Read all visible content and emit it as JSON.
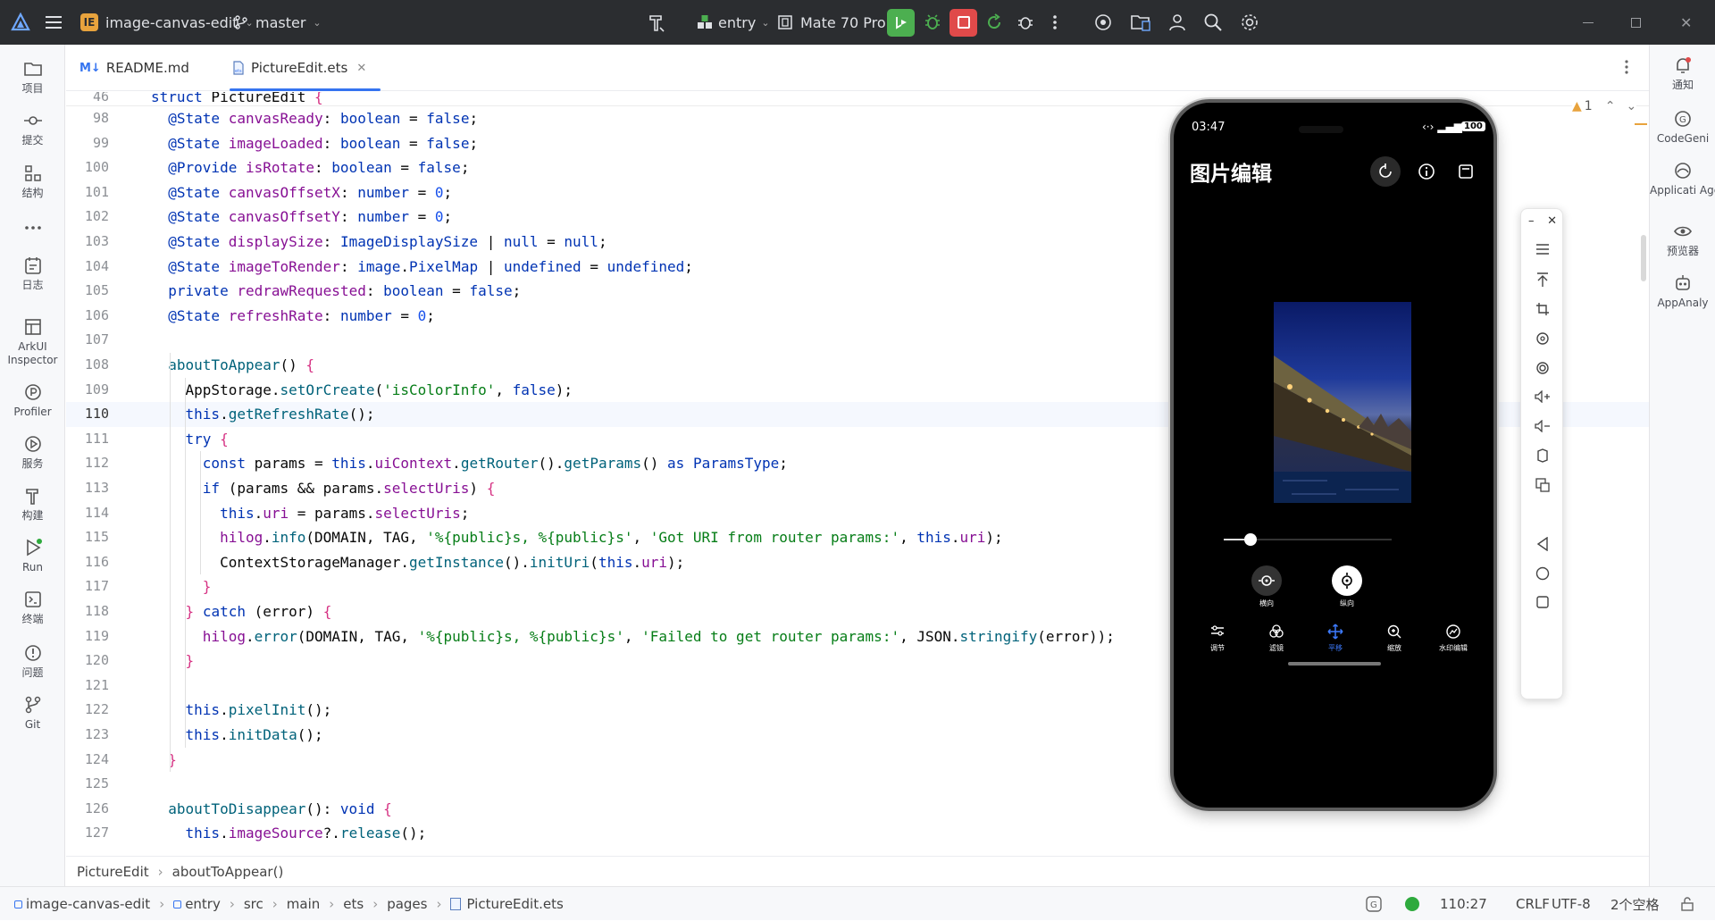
{
  "titlebar": {
    "project_badge": "IE",
    "project_name": "image-canvas-edit",
    "branch": "master",
    "run_config": "entry",
    "device": "Mate 70 Pro"
  },
  "colors": {
    "titlebar_bg": "#2b2d30",
    "run_green": "#4caf50",
    "stop_red": "#e04a4a",
    "project_badge": "#e8a33d",
    "accent_blue": "#3574f0",
    "phone_accent": "#3d7bff"
  },
  "leftbar": [
    {
      "label": "项目",
      "icon": "folder-icon"
    },
    {
      "label": "提交",
      "icon": "commit-icon"
    },
    {
      "label": "结构",
      "icon": "structure-icon"
    },
    {
      "label": "",
      "icon": "more-icon"
    },
    {
      "label": "日志",
      "icon": "log-icon"
    },
    {
      "label": "ArkUI Inspector",
      "icon": "inspector-icon"
    },
    {
      "label": "Profiler",
      "icon": "profiler-icon"
    },
    {
      "label": "服务",
      "icon": "services-icon"
    },
    {
      "label": "构建",
      "icon": "build-icon"
    },
    {
      "label": "Run",
      "icon": "run-icon"
    },
    {
      "label": "终端",
      "icon": "terminal-icon"
    },
    {
      "label": "问题",
      "icon": "problems-icon"
    },
    {
      "label": "Git",
      "icon": "git-icon"
    }
  ],
  "rightbar": [
    {
      "label": "通知",
      "icon": "bell-icon"
    },
    {
      "label": "CodeGeni",
      "icon": "codegenie-icon"
    },
    {
      "label": "Applicati Agent",
      "icon": "agent-icon"
    },
    {
      "label": "预览器",
      "icon": "eye-icon"
    },
    {
      "label": "AppAnaly",
      "icon": "robot-icon"
    }
  ],
  "tabs": [
    {
      "label": "README.md",
      "prefix": "M↓",
      "active": false
    },
    {
      "label": "PictureEdit.ets",
      "active": true
    }
  ],
  "editor": {
    "warning_count": "1",
    "sticky_line": {
      "num": "46",
      "html": "<span class='kw'>struct</span> PictureEdit <span class='br'>{</span>"
    },
    "current_line": "110",
    "lines": [
      {
        "num": "98",
        "html": "  <span class='kw'>@State</span> <span class='fl'>canvasReady</span>: <span class='ty'>boolean</span> = <span class='lit'>false</span>;"
      },
      {
        "num": "99",
        "html": "  <span class='kw'>@State</span> <span class='fl'>imageLoaded</span>: <span class='ty'>boolean</span> = <span class='lit'>false</span>;"
      },
      {
        "num": "100",
        "html": "  <span class='kw'>@Provide</span> <span class='fl'>isRotate</span>: <span class='ty'>boolean</span> = <span class='lit'>false</span>;"
      },
      {
        "num": "101",
        "html": "  <span class='kw'>@State</span> <span class='fl'>canvasOffsetX</span>: <span class='ty'>number</span> = <span class='nm'>0</span>;"
      },
      {
        "num": "102",
        "html": "  <span class='kw'>@State</span> <span class='fl'>canvasOffsetY</span>: <span class='ty'>number</span> = <span class='nm'>0</span>;"
      },
      {
        "num": "103",
        "html": "  <span class='kw'>@State</span> <span class='fl'>displaySize</span>: <span class='ty'>ImageDisplaySize</span> | <span class='lit'>null</span> = <span class='lit'>null</span>;"
      },
      {
        "num": "104",
        "html": "  <span class='kw'>@State</span> <span class='fl'>imageToRender</span>: <span class='ty'>image</span>.<span class='ty'>PixelMap</span> | <span class='lit'>undefined</span> = <span class='lit'>undefined</span>;"
      },
      {
        "num": "105",
        "html": "  <span class='kw'>private</span> <span class='fl'>redrawRequested</span>: <span class='ty'>boolean</span> = <span class='lit'>false</span>;"
      },
      {
        "num": "106",
        "html": "  <span class='kw'>@State</span> <span class='fl'>refreshRate</span>: <span class='ty'>number</span> = <span class='nm'>0</span>;"
      },
      {
        "num": "107",
        "html": ""
      },
      {
        "num": "108",
        "html": "  <span class='fn'>aboutToAppear</span>() <span class='br'>{</span>"
      },
      {
        "num": "109",
        "html": "    AppStorage.<span class='fn'>setOrCreate</span>(<span class='st'>'isColorInfo'</span>, <span class='lit'>false</span>);"
      },
      {
        "num": "110",
        "html": "    <span class='kw'>this</span>.<span class='fn'>getRefreshRate</span>();"
      },
      {
        "num": "111",
        "html": "    <span class='kw'>try</span> <span class='br'>{</span>"
      },
      {
        "num": "112",
        "html": "      <span class='kw'>const</span> params = <span class='kw'>this</span>.<span class='fl'>uiContext</span>.<span class='fn'>getRouter</span>().<span class='fn'>getParams</span>() <span class='kw'>as</span> <span class='ty'>ParamsType</span>;"
      },
      {
        "num": "113",
        "html": "      <span class='kw'>if</span> (params && params.<span class='fl'>selectUris</span>) <span class='br'>{</span>"
      },
      {
        "num": "114",
        "html": "        <span class='kw'>this</span>.<span class='fl'>uri</span> = params.<span class='fl'>selectUris</span>;"
      },
      {
        "num": "115",
        "html": "        <span class='fl'>hilog</span>.<span class='fn'>info</span>(DOMAIN, TAG, <span class='st'>'%{public}s, %{public}s'</span>, <span class='st'>'Got URI from router params:'</span>, <span class='kw'>this</span>.<span class='fl'>uri</span>);"
      },
      {
        "num": "116",
        "html": "        ContextStorageManager.<span class='fn'>getInstance</span>().<span class='fn'>initUri</span>(<span class='kw'>this</span>.<span class='fl'>uri</span>);"
      },
      {
        "num": "117",
        "html": "      <span class='br'>}</span>"
      },
      {
        "num": "118",
        "html": "    <span class='br'>}</span> <span class='kw'>catch</span> (error) <span class='br'>{</span>"
      },
      {
        "num": "119",
        "html": "      <span class='fl'>hilog</span>.<span class='fn'>error</span>(DOMAIN, TAG, <span class='st'>'%{public}s, %{public}s'</span>, <span class='st'>'Failed to get router params:'</span>, JSON.<span class='fn'>stringify</span>(error));"
      },
      {
        "num": "120",
        "html": "    <span class='br'>}</span>"
      },
      {
        "num": "121",
        "html": ""
      },
      {
        "num": "122",
        "html": "    <span class='kw'>this</span>.<span class='fn'>pixelInit</span>();"
      },
      {
        "num": "123",
        "html": "    <span class='kw'>this</span>.<span class='fn'>initData</span>();"
      },
      {
        "num": "124",
        "html": "  <span class='br'>}</span>"
      },
      {
        "num": "125",
        "html": ""
      },
      {
        "num": "126",
        "html": "  <span class='fn'>aboutToDisappear</span>(): <span class='ty'>void</span> <span class='br'>{</span>"
      },
      {
        "num": "127",
        "html": "    <span class='kw'>this</span>.<span class='fl'>imageSource</span>?.<span class='fn'>release</span>();"
      }
    ]
  },
  "breadcrumb": [
    "PictureEdit",
    "aboutToAppear()"
  ],
  "statusbar": {
    "path": [
      "image-canvas-edit",
      "entry",
      "src",
      "main",
      "ets",
      "pages",
      "PictureEdit.ets"
    ],
    "position": "110:27",
    "line_ending": "CRLF",
    "encoding": "UTF-8",
    "indent": "2个空格"
  },
  "phone": {
    "time": "03:47",
    "battery": "100",
    "app_title": "图片编辑",
    "slider_value": 0.16,
    "modes": [
      {
        "label": "横向"
      },
      {
        "label": "纵向"
      }
    ],
    "bottom_tabs": [
      {
        "label": "调节",
        "icon": "sliders-icon"
      },
      {
        "label": "滤镜",
        "icon": "filter-icon"
      },
      {
        "label": "平移",
        "icon": "move-icon",
        "active": true
      },
      {
        "label": "缩放",
        "icon": "zoom-icon"
      },
      {
        "label": "水印编辑",
        "icon": "watermark-icon"
      }
    ]
  }
}
